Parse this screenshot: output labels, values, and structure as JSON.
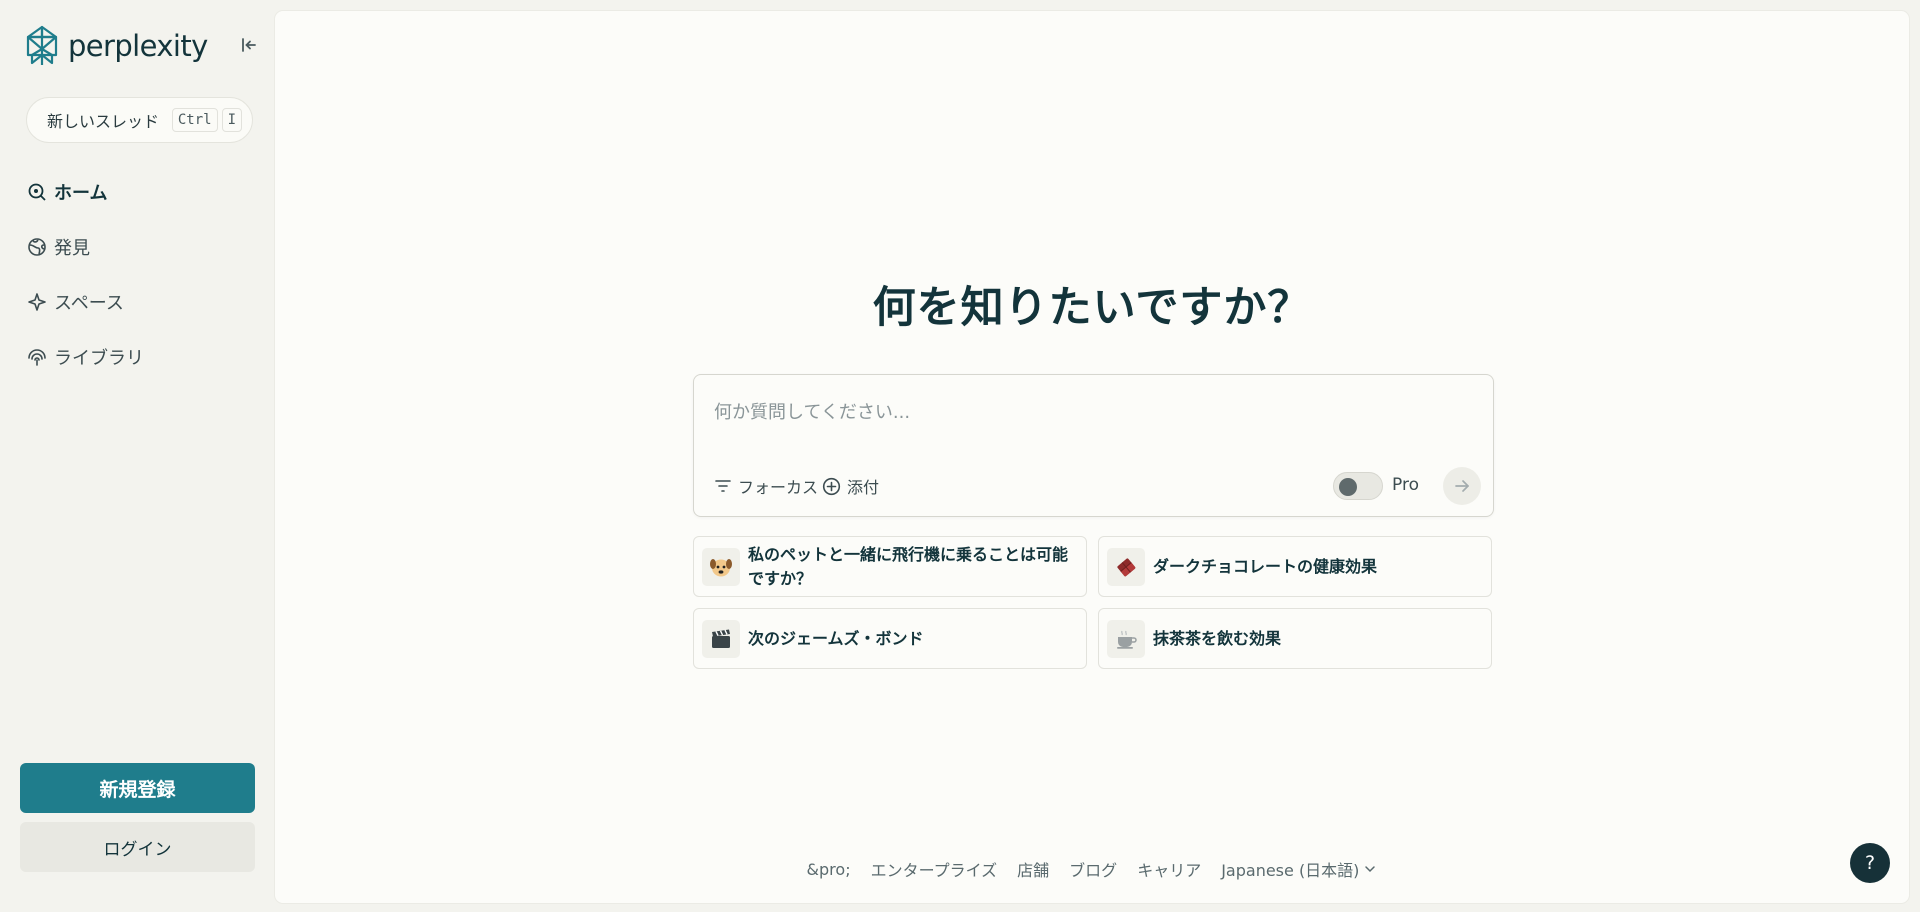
{
  "brand": {
    "name": "perplexity",
    "accent": "#1f7d8c",
    "dark": "#13343b"
  },
  "sidebar": {
    "new_thread": {
      "label": "新しいスレッド",
      "shortcut_keys": [
        "Ctrl",
        "I"
      ]
    },
    "nav": [
      {
        "label": "ホーム",
        "icon": "home-search-icon",
        "active": true
      },
      {
        "label": "発見",
        "icon": "globe-icon",
        "active": false
      },
      {
        "label": "スペース",
        "icon": "sparkle-icon",
        "active": false
      },
      {
        "label": "ライブラリ",
        "icon": "library-icon",
        "active": false
      }
    ],
    "signup_label": "新規登録",
    "login_label": "ログイン"
  },
  "main": {
    "headline": "何を知りたいですか？",
    "ask": {
      "placeholder": "何か質問してください...",
      "value": "",
      "focus_label": "フォーカス",
      "attach_label": "添付",
      "pro_label": "Pro",
      "pro_enabled": false
    },
    "suggestions": [
      {
        "emoji": "🐶",
        "text": "私のペットと一緒に飛行機に乗ることは可能ですか？"
      },
      {
        "emoji": "🍫",
        "text": "ダークチョコレートの健康効果"
      },
      {
        "emoji": "🎬",
        "text": "次のジェームズ・ボンド"
      },
      {
        "emoji": "🍵",
        "text": "抹茶茶を飲む効果"
      }
    ],
    "footer": {
      "links": [
        "&pro;",
        "エンタープライズ",
        "店舗",
        "ブログ",
        "キャリア"
      ],
      "language": "Japanese (日本語)"
    },
    "help_label": "?"
  }
}
